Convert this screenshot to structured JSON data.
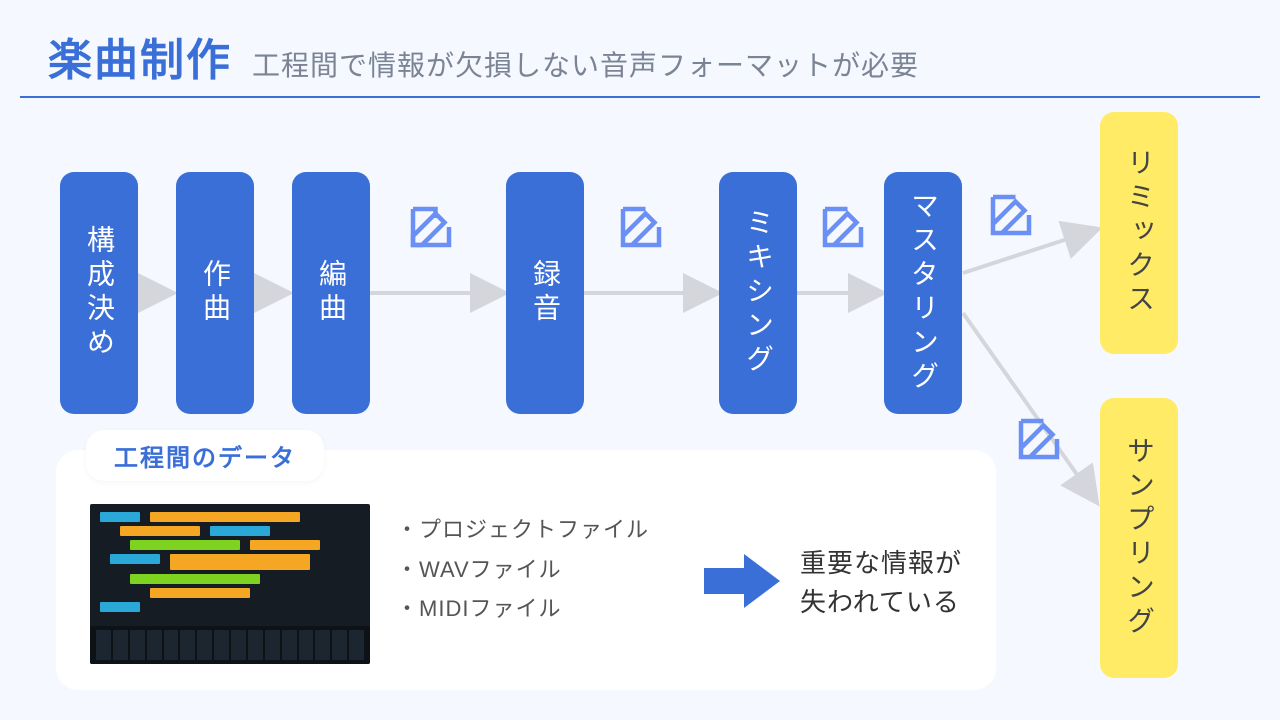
{
  "header": {
    "title": "楽曲制作",
    "subtitle": "工程間で情報が欠損しない音声フォーマットが必要"
  },
  "stages": {
    "s1": "構成決め",
    "s2": "作曲",
    "s3": "編曲",
    "s4": "録音",
    "s5": "ミキシング",
    "s6": "マスタリング",
    "s7": "リミックス",
    "s8": "サンプリング"
  },
  "panel": {
    "title": "工程間のデータ",
    "files": {
      "f1": "・プロジェクトファイル",
      "f2": "・WAVファイル",
      "f3": "・MIDIファイル"
    },
    "conclusion_line1": "重要な情報が",
    "conclusion_line2": "失われている"
  },
  "icons": {
    "edit": "edit-icon",
    "arrow": "arrow-icon"
  },
  "colors": {
    "primary": "#3a6fd8",
    "accent": "#ffeb66",
    "arrow_gray": "#d4d6db",
    "edit_blue": "#6a8ff5"
  }
}
